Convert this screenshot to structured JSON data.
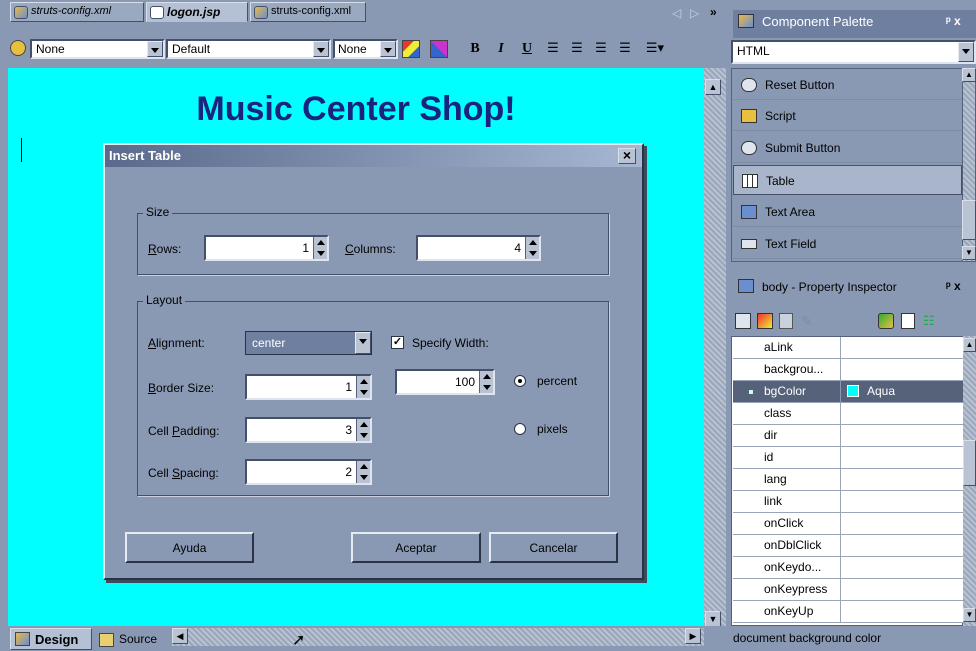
{
  "editor": {
    "tabs": [
      "struts-config.xml",
      "logon.jsp",
      "struts-config.xml"
    ],
    "toolbar": {
      "style_value": "None",
      "font_value": "Default",
      "size_value": "None",
      "bold": "B",
      "italic": "I",
      "underline": "U"
    },
    "page_heading": "Music Center Shop!",
    "page_bg_color": "#00ffff",
    "bottom_tabs": [
      "Design",
      "Source"
    ]
  },
  "dialog": {
    "title": "Insert Table",
    "close": "×",
    "size_group": "Size",
    "rows_label": "Rows:",
    "rows_value": "1",
    "columns_label": "Columns:",
    "columns_value": "4",
    "layout_group": "Layout",
    "alignment_label": "Alignment:",
    "alignment_value": "center",
    "specify_width_label": "Specify Width:",
    "specify_width_checked": true,
    "width_value": "100",
    "percent_label": "percent",
    "pixels_label": "pixels",
    "unit_selected": "percent",
    "border_label": "Border Size:",
    "border_value": "1",
    "padding_label": "Cell Padding:",
    "padding_value": "3",
    "spacing_label": "Cell Spacing:",
    "spacing_value": "2",
    "help_button": "Ayuda",
    "ok_button": "Aceptar",
    "cancel_button": "Cancelar"
  },
  "palette": {
    "title": "Component Palette",
    "pin": "ᵖ x",
    "category": "HTML",
    "items": [
      "Reset Button",
      "Script",
      "Submit Button",
      "Table",
      "Text Area",
      "Text Field"
    ],
    "selected": "Table"
  },
  "inspector": {
    "title": "body - Property Inspector",
    "pin": "ᵖ x",
    "properties": [
      {
        "name": "aLink",
        "value": ""
      },
      {
        "name": "backgrou...",
        "value": ""
      },
      {
        "name": "bgColor",
        "value": "Aqua"
      },
      {
        "name": "class",
        "value": ""
      },
      {
        "name": "dir",
        "value": ""
      },
      {
        "name": "id",
        "value": ""
      },
      {
        "name": "lang",
        "value": ""
      },
      {
        "name": "link",
        "value": ""
      },
      {
        "name": "onClick",
        "value": ""
      },
      {
        "name": "onDblClick",
        "value": ""
      },
      {
        "name": "onKeydo...",
        "value": ""
      },
      {
        "name": "onKeypress",
        "value": ""
      },
      {
        "name": "onKeyUp",
        "value": ""
      }
    ],
    "selected_property": "bgColor",
    "aqua_swatch": "#00ffff",
    "status": "document background color"
  }
}
